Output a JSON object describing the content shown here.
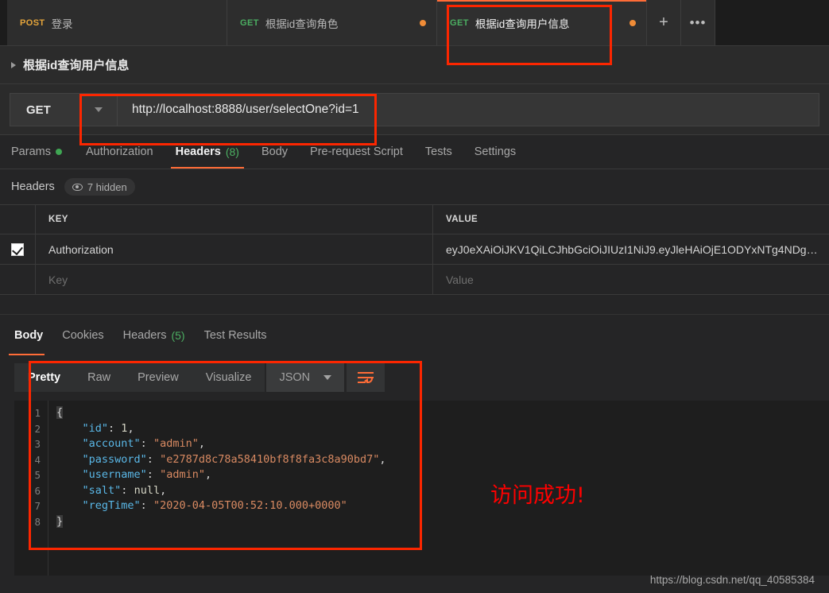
{
  "tabs": [
    {
      "method": "POST",
      "method_class": "post",
      "name": "登录",
      "unsaved": false,
      "active": false
    },
    {
      "method": "GET",
      "method_class": "get",
      "name": "根据id查询角色",
      "unsaved": true,
      "active": false
    },
    {
      "method": "GET",
      "method_class": "get",
      "name": "根据id查询用户信息",
      "unsaved": true,
      "active": true
    }
  ],
  "tabstrip": {
    "new_tab_label": "+",
    "more_label": "•••"
  },
  "request": {
    "name": "根据id查询用户信息",
    "method": "GET",
    "url": "http://localhost:8888/user/selectOne?id=1",
    "subtabs": [
      {
        "label": "Params",
        "dot": true,
        "count": "",
        "active": false
      },
      {
        "label": "Authorization",
        "dot": false,
        "count": "",
        "active": false
      },
      {
        "label": "Headers",
        "dot": false,
        "count": "(8)",
        "active": true
      },
      {
        "label": "Body",
        "dot": false,
        "count": "",
        "active": false
      },
      {
        "label": "Pre-request Script",
        "dot": false,
        "count": "",
        "active": false
      },
      {
        "label": "Tests",
        "dot": false,
        "count": "",
        "active": false
      },
      {
        "label": "Settings",
        "dot": false,
        "count": "",
        "active": false
      }
    ]
  },
  "headers_panel": {
    "label": "Headers",
    "hidden_pill": "7 hidden",
    "columns": [
      "KEY",
      "VALUE"
    ],
    "rows": [
      {
        "checked": true,
        "key": "Authorization",
        "value": "eyJ0eXAiOiJKV1QiLCJhbGciOiJIUzI1NiJ9.eyJleHAiOjE1ODYxNTg4NDg…"
      }
    ],
    "new_row": {
      "key_placeholder": "Key",
      "value_placeholder": "Value"
    }
  },
  "response": {
    "tabs": [
      {
        "label": "Body",
        "count": "",
        "active": true
      },
      {
        "label": "Cookies",
        "count": "",
        "active": false
      },
      {
        "label": "Headers",
        "count": "(5)",
        "active": false
      },
      {
        "label": "Test Results",
        "count": "",
        "active": false
      }
    ],
    "viewer": {
      "view_tabs": [
        {
          "label": "Pretty",
          "active": true
        },
        {
          "label": "Raw",
          "active": false
        },
        {
          "label": "Preview",
          "active": false
        },
        {
          "label": "Visualize",
          "active": false
        }
      ],
      "format": "JSON",
      "wrap_icon": "wrap-lines-icon"
    },
    "body_lines": [
      {
        "no": "1",
        "html": "{"
      },
      {
        "no": "2",
        "html": "    \"id\": 1,"
      },
      {
        "no": "3",
        "html": "    \"account\": \"admin\","
      },
      {
        "no": "4",
        "html": "    \"password\": \"e2787d8c78a58410bf8f8fa3c8a90bd7\","
      },
      {
        "no": "5",
        "html": "    \"username\": \"admin\","
      },
      {
        "no": "6",
        "html": "    \"salt\": null,"
      },
      {
        "no": "7",
        "html": "    \"regTime\": \"2020-04-05T00:52:10.000+0000\""
      },
      {
        "no": "8",
        "html": "}"
      }
    ],
    "body_object": {
      "id": 1,
      "account": "admin",
      "password": "e2787d8c78a58410bf8f8fa3c8a90bd7",
      "username": "admin",
      "salt": null,
      "regTime": "2020-04-05T00:52:10.000+0000"
    }
  },
  "annotation": "访问成功!",
  "watermark": "https://blog.csdn.net/qq_40585384",
  "colors": {
    "accent_orange": "#ff6c37",
    "highlight_red": "#fc2600",
    "annotation_red": "#ff0000",
    "get_green": "#4caf62",
    "post_orange": "#e5a53b",
    "unsaved_dot": "#f08c37",
    "params_dot_green": "#3fa653",
    "json_key_blue": "#5ab8e8",
    "json_string_orange": "#d98a62"
  }
}
